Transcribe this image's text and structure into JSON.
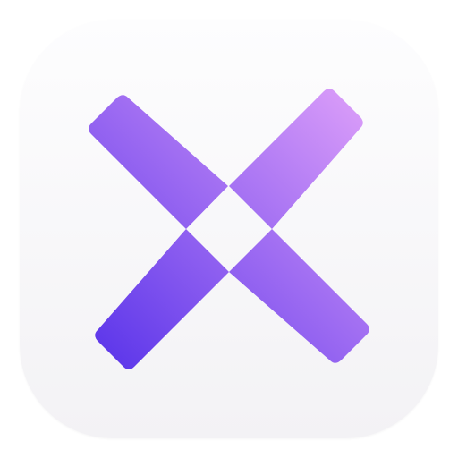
{
  "app_icon": {
    "name": "app-icon",
    "symbol": "x-mark-icon",
    "colors": {
      "background_top": "#fdfdfe",
      "background_bottom": "#f3f2f5",
      "gradient_start": "#5c36ea",
      "gradient_end": "#d99cf9"
    }
  }
}
